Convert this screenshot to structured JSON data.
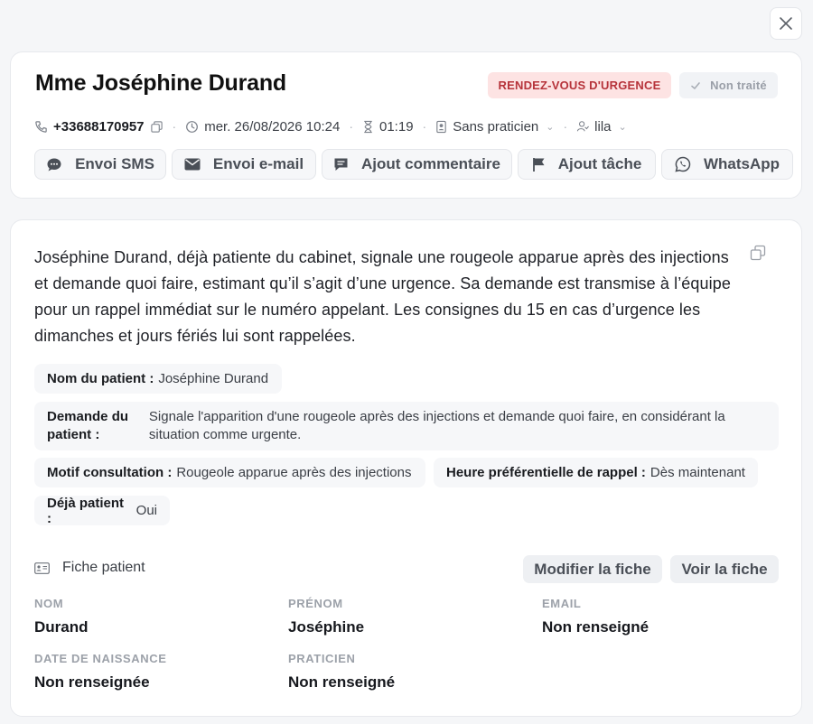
{
  "dialog": {
    "close_icon": "close-icon"
  },
  "header": {
    "title": "Mme Joséphine Durand",
    "badge_urgent": "RENDEZ-VOUS D'URGENCE",
    "badge_status": "Non traité",
    "phone": "+33688170957",
    "datetime": "mer. 26/08/2026 10:24",
    "duration": "01:19",
    "practitioner": "Sans praticien",
    "assignee": "lila",
    "actions": [
      {
        "label": "Envoi SMS",
        "icon": "sms-icon"
      },
      {
        "label": "Envoi e-mail",
        "icon": "mail-icon"
      },
      {
        "label": "Ajout commentaire",
        "icon": "comment-icon"
      },
      {
        "label": "Ajout tâche",
        "icon": "flag-icon"
      },
      {
        "label": "WhatsApp",
        "icon": "whatsapp-icon"
      }
    ]
  },
  "summary": {
    "text": "Joséphine Durand, déjà patiente du cabinet, signale une rougeole apparue après des injections et demande quoi faire, estimant qu’il s’agit d’une urgence. Sa demande est transmise à l’équipe pour un rappel immédiat sur le numéro appelant. Les consignes du 15 en cas d’urgence les dimanches et jours fériés lui sont rappelées."
  },
  "details": {
    "nom_label": "Nom du patient :",
    "nom_value": "Joséphine Durand",
    "demande_label": "Demande du patient :",
    "demande_value": "Signale l'apparition d'une rougeole après des injections et demande quoi faire, en considérant la situation comme urgente.",
    "motif_label": "Motif consultation :",
    "motif_value": "Rougeole apparue après des injections",
    "heure_label": "Heure préférentielle de rappel :",
    "heure_value": "Dès maintenant",
    "deja_label": "Déjà patient :",
    "deja_value": "Oui"
  },
  "fiche": {
    "title": "Fiche patient",
    "modify_label": "Modifier la fiche",
    "view_label": "Voir la fiche",
    "fields": {
      "nom": {
        "label": "NOM",
        "value": "Durand"
      },
      "prenom": {
        "label": "PRÉNOM",
        "value": "Joséphine"
      },
      "email": {
        "label": "EMAIL",
        "value": "Non renseigné"
      },
      "naissance": {
        "label": "DATE DE NAISSANCE",
        "value": "Non renseignée"
      },
      "praticien": {
        "label": "PRATICIEN",
        "value": "Non renseigné"
      }
    }
  },
  "colors": {
    "urgent_bg": "#fde3e3",
    "urgent_text": "#b6333a",
    "chip_bg": "#f6f7f9"
  }
}
